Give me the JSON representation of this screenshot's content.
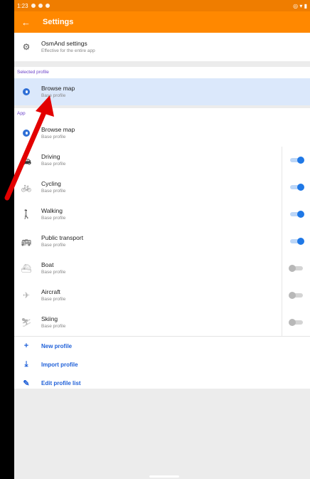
{
  "status": {
    "time": "1:23",
    "right": "◎ ▾ ▮"
  },
  "app_bar": {
    "title": "Settings",
    "back_icon": "arrow-back-icon"
  },
  "osmand": {
    "title": "OsmAnd settings",
    "subtitle": "Effective for the entire app",
    "icon": "gear-icon"
  },
  "selected_section": {
    "label": "Selected profile"
  },
  "selected_profile": {
    "title": "Browse map",
    "subtitle": "Base profile",
    "icon": "globe-icon"
  },
  "app_profiles_section": {
    "label": "App"
  },
  "profiles": [
    {
      "title": "Browse map",
      "subtitle": "Base profile",
      "icon": "globe-icon",
      "toggle": null
    },
    {
      "title": "Driving",
      "subtitle": "Base profile",
      "icon": "car-icon",
      "toggle": true
    },
    {
      "title": "Cycling",
      "subtitle": "Base profile",
      "icon": "bicycle-icon",
      "toggle": true
    },
    {
      "title": "Walking",
      "subtitle": "Base profile",
      "icon": "walking-icon",
      "toggle": true
    },
    {
      "title": "Public transport",
      "subtitle": "Base profile",
      "icon": "bus-icon",
      "toggle": true
    },
    {
      "title": "Boat",
      "subtitle": "Base profile",
      "icon": "boat-icon",
      "toggle": false
    },
    {
      "title": "Aircraft",
      "subtitle": "Base profile",
      "icon": "airplane-icon",
      "toggle": false
    },
    {
      "title": "Skiing",
      "subtitle": "Base profile",
      "icon": "skiing-icon",
      "toggle": false
    }
  ],
  "actions": [
    {
      "label": "New profile",
      "icon": "plus-icon"
    },
    {
      "label": "Import profile",
      "icon": "download-icon"
    },
    {
      "label": "Edit profile list",
      "icon": "pencil-icon"
    }
  ],
  "colors": {
    "app_bar": "#ff8800",
    "status_bar": "#ef7d00",
    "accent": "#1f78e6",
    "selected_bg": "#dbe8fb",
    "annotation_arrow": "#e30000"
  }
}
